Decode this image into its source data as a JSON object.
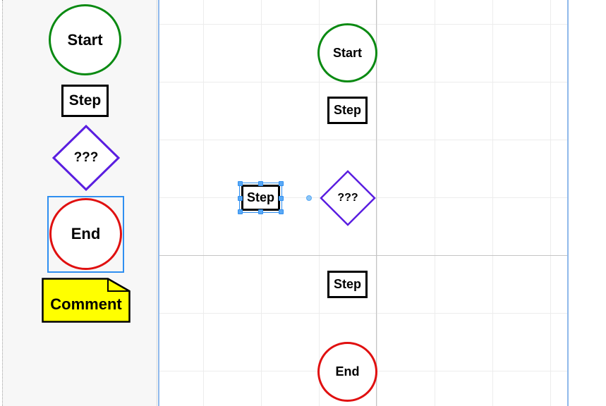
{
  "palette": {
    "start_label": "Start",
    "step_label": "Step",
    "decision_label": "???",
    "end_label": "End",
    "comment_label": "Comment"
  },
  "canvas": {
    "start_label": "Start",
    "step1_label": "Step",
    "selected_step_label": "Step",
    "decision_label": "???",
    "step2_label": "Step",
    "end_label": "End"
  },
  "colors": {
    "start": "#0a8a12",
    "end": "#e01010",
    "decision": "#5a1ee0",
    "comment_fill": "#ffff00",
    "selection": "#2f8ff0"
  }
}
